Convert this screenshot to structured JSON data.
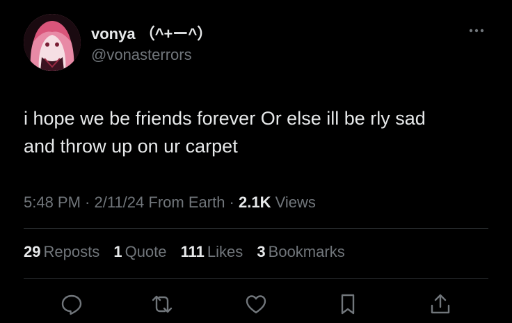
{
  "author": {
    "display_name": "vonya （^+ー^）",
    "handle": "@vonasterrors"
  },
  "tweet": {
    "text_line_1": "i hope we be friends forever Or else ill be rly sad",
    "text_line_2": "and throw up on ur carpet"
  },
  "meta": {
    "time": "5:48 PM",
    "date": "2/11/24",
    "source": "From Earth",
    "views_count": "2.1K",
    "views_label": "Views"
  },
  "stats": {
    "reposts_count": "29",
    "reposts_label": "Reposts",
    "quotes_count": "1",
    "quotes_label": "Quote",
    "likes_count": "111",
    "likes_label": "Likes",
    "bookmarks_count": "3",
    "bookmarks_label": "Bookmarks"
  },
  "icons": {
    "more": "more-horizontal-icon",
    "reply": "reply-icon",
    "repost": "repost-icon",
    "like": "heart-icon",
    "bookmark": "bookmark-icon",
    "share": "share-icon"
  },
  "colors": {
    "background": "#000000",
    "primary_text": "#e7e9ea",
    "secondary_text": "#71767b",
    "divider": "#2f3336"
  }
}
